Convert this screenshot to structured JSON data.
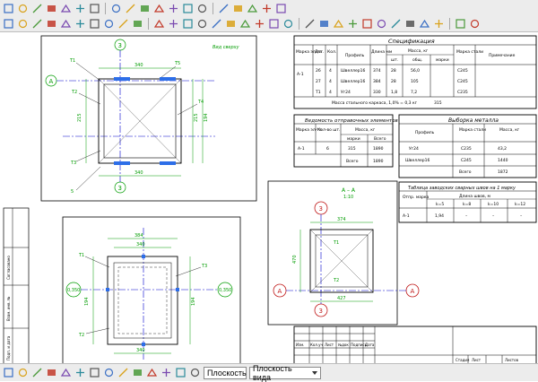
{
  "toolbar_top": {
    "icons": [
      "new-file-icon",
      "open-icon",
      "save-icon",
      "save-all-icon",
      "print-icon",
      "print-preview-icon",
      "export-icon",
      "undo-icon",
      "redo-icon",
      "zoom-in-icon",
      "zoom-out-icon",
      "zoom-window-icon",
      "pan-icon",
      "help-icon",
      "layers-icon",
      "properties-icon",
      "calculator-icon",
      "close-icon",
      "book-icon"
    ]
  },
  "toolbar_draw": {
    "icons": [
      "select-icon",
      "dimension-icon",
      "grid-icon",
      "snap-icon",
      "ortho-icon",
      "pointer-icon",
      "measure-icon",
      "text-icon",
      "edit-icon",
      "hatch-icon",
      "line-icon",
      "rectangle-icon",
      "circle-icon",
      "arc-icon",
      "polyline-icon",
      "spline-icon",
      "ellipse-icon",
      "polygon-icon",
      "offset-icon",
      "trim-icon",
      "extend-icon",
      "mirror-icon",
      "copy-icon",
      "move-icon",
      "rotate-icon",
      "scale-icon",
      "array-icon",
      "fillet-icon",
      "chamfer-icon",
      "break-icon",
      "join-icon",
      "erase-icon"
    ]
  },
  "drawing": {
    "view1": {
      "title": "Вид сверху",
      "axis_a": "А",
      "axis_3": "3",
      "dims": [
        "340",
        "340",
        "215",
        "215",
        "194"
      ],
      "marks": [
        "Т1",
        "Т2",
        "Т3",
        "Т4",
        "Т5",
        "5"
      ]
    },
    "view2": {
      "axis_left": "0,350",
      "axis_right": "0,350",
      "dims": [
        "384",
        "340",
        "194",
        "340",
        "194"
      ],
      "marks": [
        "Т1",
        "Т2",
        "Т3"
      ]
    },
    "section": {
      "title": "А – А",
      "scale": "1:10",
      "axis_a": "А",
      "axis_3": "3",
      "dims": [
        "374",
        "470",
        "427"
      ],
      "marks": [
        "Т1",
        "Т2"
      ]
    },
    "spec": {
      "title": "Спецификация",
      "headers": [
        "Марка эл-та",
        "Дет.",
        "Кол.",
        "Профиль",
        "Длина мм",
        "Масса, кг",
        "",
        "",
        "Марка стали",
        "Примечание"
      ],
      "sub_headers": [
        "шт.",
        "общ.",
        "марки"
      ],
      "rows": [
        [
          "А-1",
          "26",
          "4",
          "Швеллер16",
          "374",
          "28",
          "56,0",
          "",
          "С245",
          ""
        ],
        [
          "",
          "27",
          "4",
          "Швеллер16",
          "384",
          "28",
          "105",
          "",
          "С245",
          ""
        ],
        [
          "",
          "Т1",
          "4",
          "Уг24",
          "330",
          "1,8",
          "7,2",
          "",
          "С235",
          ""
        ]
      ],
      "total": "Масса стального каркаса, 1,0% = 0,3 кг",
      "total_val": "315"
    },
    "vedomost": {
      "title": "Ведомость отправочных элементов",
      "headers": [
        "Марка эл-та",
        "Кол-во шт.",
        "Масса, кг",
        "марки",
        "Всего"
      ],
      "row": [
        "А-1",
        "6",
        "315",
        "1890"
      ],
      "total_label": "Всего",
      "total_val": "1890"
    },
    "vyborka": {
      "title": "Выборка металла",
      "headers": [
        "Профиль",
        "Марка стали",
        "Масса, кг"
      ],
      "rows": [
        [
          "Уг24",
          "С235",
          "43,2"
        ],
        [
          "Швеллер16",
          "С245",
          "1440"
        ]
      ],
      "total_label": "Всего",
      "total_val": "1872"
    },
    "welds": {
      "title": "Таблица заводских сварных швов на 1 марку",
      "headers": [
        "Отпр. марка",
        "Длина швов, м",
        "k=5",
        "k=8",
        "k=10",
        "k=12"
      ],
      "row": [
        "А-1",
        "1,94",
        "–",
        "–",
        "–"
      ]
    },
    "stamp": {
      "lbl1": "Изм.",
      "lbl2": "Кол.уч",
      "lbl3": "Лист",
      "lbl4": "№док",
      "lbl5": "Подпись",
      "lbl6": "Дата",
      "lbl7": "Стадия",
      "lbl8": "Лист",
      "lbl9": "Листов"
    },
    "side": {
      "l1": "Инв. № подл.",
      "l2": "Подп. и дата",
      "l3": "Взам. инв. №",
      "l4": "Согласовано"
    }
  },
  "bottom_bar": {
    "icons": [
      "layer-icon",
      "snap-grid-icon",
      "osnap-icon",
      "color-icon",
      "lineweight-icon",
      "linetype-icon",
      "text-style-icon",
      "hatch-style-icon",
      "dim-style-icon",
      "block-icon",
      "check-icon",
      "print-area-icon",
      "sheet-icon",
      "model-icon"
    ],
    "plane_select": "Плоскость",
    "view_select": "Плоскость вида"
  },
  "colors": {
    "dim": "#009c00",
    "axis": "#0000cc",
    "line": "#000000",
    "selected": "#2d6ee8",
    "accent": "#c01818"
  }
}
